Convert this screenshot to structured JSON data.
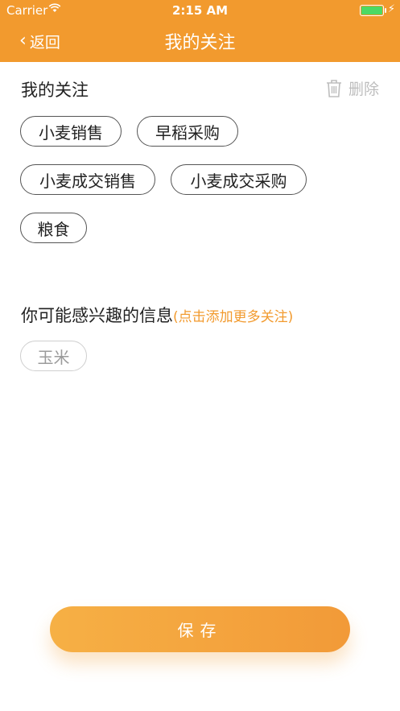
{
  "status_bar": {
    "carrier": "Carrier",
    "time": "2:15 AM",
    "battery_color": "#4cd964"
  },
  "nav": {
    "back_label": "返回",
    "title": "我的关注"
  },
  "my_follows": {
    "title": "我的关注",
    "delete_label": "删除",
    "tags": [
      "小麦销售",
      "早稻采购",
      "小麦成交销售",
      "小麦成交采购",
      "粮食"
    ]
  },
  "suggestions": {
    "title": "你可能感兴趣的信息",
    "hint": "(点击添加更多关注)",
    "tags": [
      "玉米"
    ]
  },
  "save_label": "保存",
  "colors": {
    "accent": "#f29a2e",
    "background": "#ffffff"
  }
}
